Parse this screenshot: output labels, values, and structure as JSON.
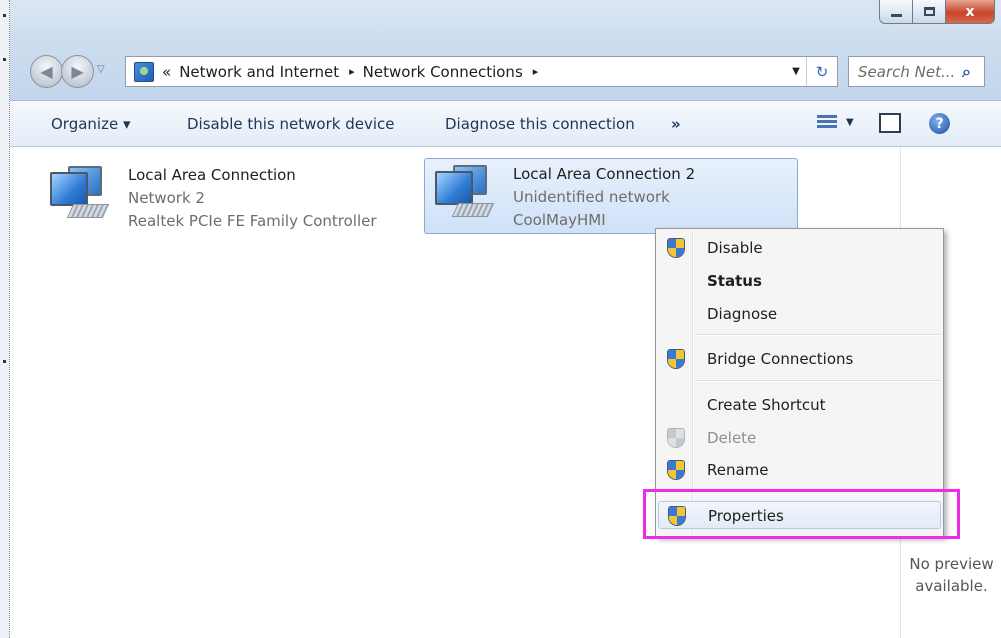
{
  "window": {
    "caption_close": "x"
  },
  "address_bar": {
    "overflow_chevron": "«",
    "crumbs": [
      "Network and Internet",
      "Network Connections"
    ],
    "separator": "▸",
    "dropdown": "▼",
    "refresh": "↻"
  },
  "search": {
    "placeholder": "Search Net..."
  },
  "nav": {
    "back": "◀",
    "forward": "▶",
    "history_dropdown": "▽"
  },
  "command_bar": {
    "organize": "Organize ▾",
    "disable_device": "Disable this network device",
    "diagnose": "Diagnose this connection",
    "more": "»",
    "view_dropdown": "▼",
    "help": "?"
  },
  "connections": [
    {
      "name": "Local Area Connection",
      "network": "Network  2",
      "adapter": "Realtek PCIe FE Family Controller",
      "selected": false
    },
    {
      "name": "Local Area Connection 2",
      "network": "Unidentified network",
      "adapter": "CoolMayHMI",
      "selected": true
    }
  ],
  "context_menu": {
    "items": [
      {
        "label": "Disable",
        "icon": "uac-shield-icon",
        "bold": false,
        "disabled": false
      },
      {
        "label": "Status",
        "icon": null,
        "bold": true,
        "disabled": false
      },
      {
        "label": "Diagnose",
        "icon": null,
        "bold": false,
        "disabled": false
      },
      {
        "label": "Bridge Connections",
        "icon": "uac-shield-icon",
        "bold": false,
        "disabled": false
      },
      {
        "label": "Create Shortcut",
        "icon": null,
        "bold": false,
        "disabled": false
      },
      {
        "label": "Delete",
        "icon": "uac-shield-icon",
        "bold": false,
        "disabled": true
      },
      {
        "label": "Rename",
        "icon": "uac-shield-icon",
        "bold": false,
        "disabled": false
      },
      {
        "label": "Properties",
        "icon": "uac-shield-icon",
        "bold": false,
        "disabled": false,
        "hover": true
      }
    ]
  },
  "preview_pane": {
    "line1": "No preview",
    "line2": "available."
  },
  "colors": {
    "highlight_box": "#ee2be8",
    "selection_fill": "#cfe1f7",
    "command_text": "#1e3556"
  }
}
